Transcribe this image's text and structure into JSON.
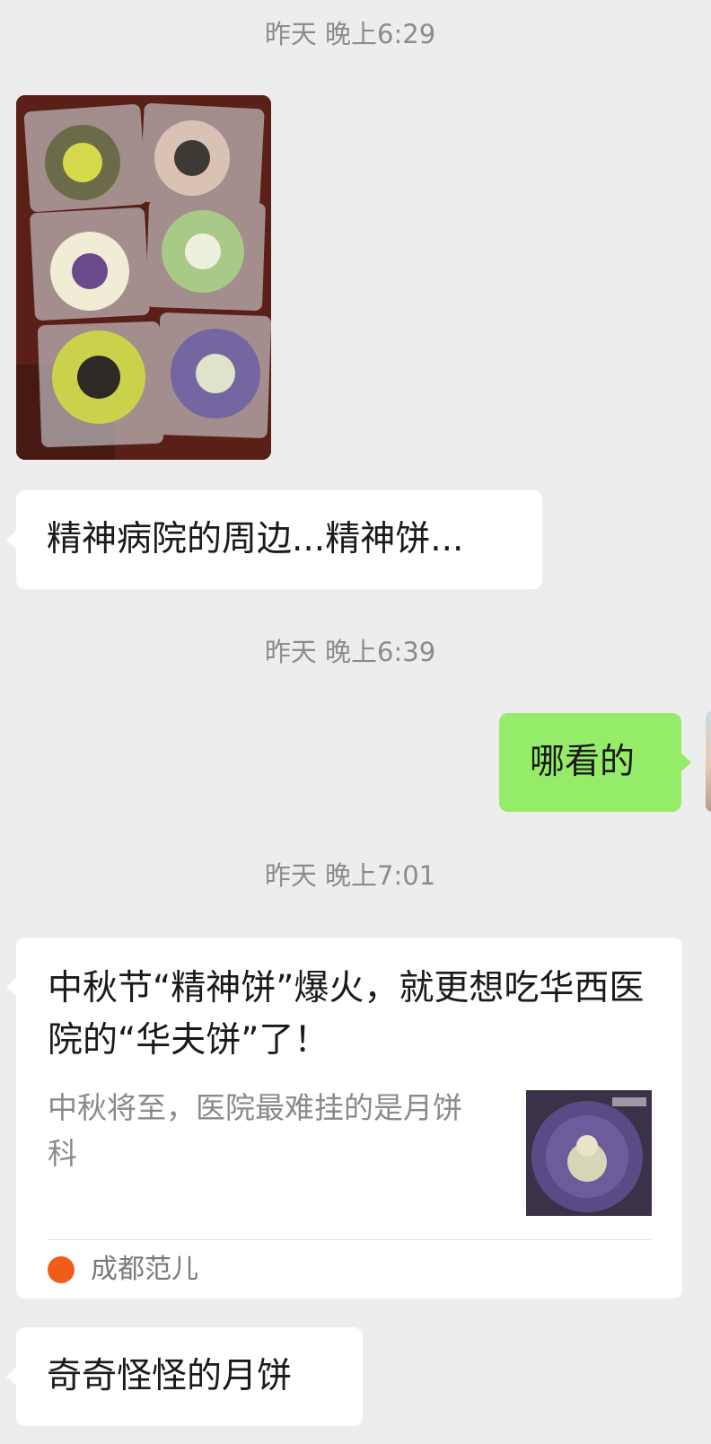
{
  "messages": {
    "ts1": "昨天 晚上6:29",
    "ts2": "昨天 晚上6:39",
    "ts3": "昨天 晚上7:01",
    "m1_text": "精神病院的周边...精神饼...",
    "m2_text": "哪看的",
    "link_card": {
      "title": "中秋节“精神饼”爆火，就更想吃华西医院的“华夫饼”了！",
      "description": "中秋将至，医院最难挂的是月饼科",
      "source": "成都范儿"
    },
    "m4_text": "奇奇怪怪的月饼"
  },
  "colors": {
    "background": "#ededed",
    "incoming_bubble": "#ffffff",
    "outgoing_bubble": "#95ec69",
    "timestamp": "#8c8c8c",
    "source_logo": "#f25c19"
  },
  "icons": {
    "source_logo": "chengdu-fan-er-logo"
  }
}
